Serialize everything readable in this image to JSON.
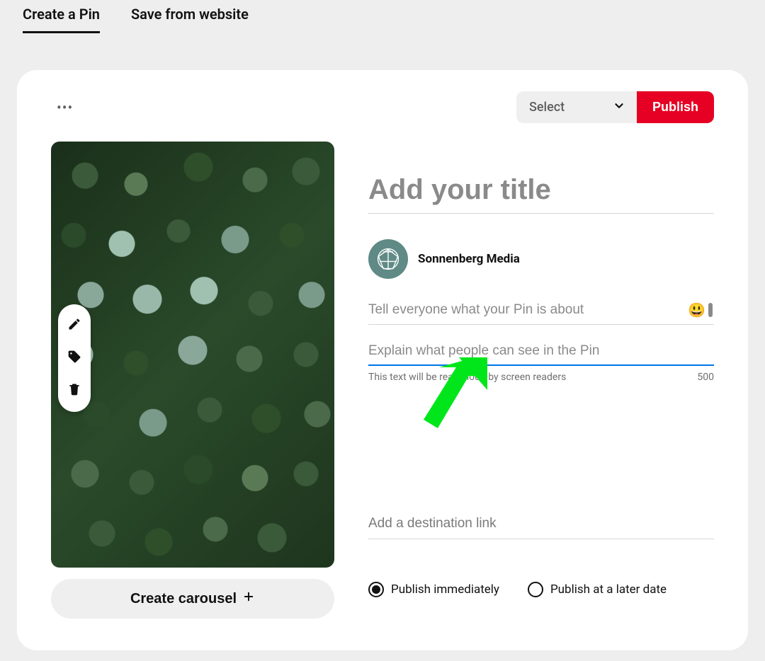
{
  "tabs": {
    "create_pin": "Create a Pin",
    "save_from_website": "Save from website"
  },
  "top": {
    "board_select_label": "Select",
    "publish_label": "Publish"
  },
  "image_tools": {
    "edit": "edit",
    "tag": "tag",
    "delete": "delete"
  },
  "carousel_button": "Create carousel",
  "form": {
    "title_placeholder": "Add your title",
    "author_name": "Sonnenberg Media",
    "description_placeholder": "Tell everyone what your Pin is about",
    "alt_placeholder": "Explain what people can see in the Pin",
    "alt_hint": "This text will be read aloud by screen readers",
    "alt_counter": "500",
    "link_placeholder": "Add a destination link"
  },
  "schedule": {
    "publish_now": "Publish immediately",
    "publish_later": "Publish at a later date"
  },
  "colors": {
    "primary_red": "#e60023",
    "focus_blue": "#0074e8",
    "annotation_green": "#00e61a"
  }
}
